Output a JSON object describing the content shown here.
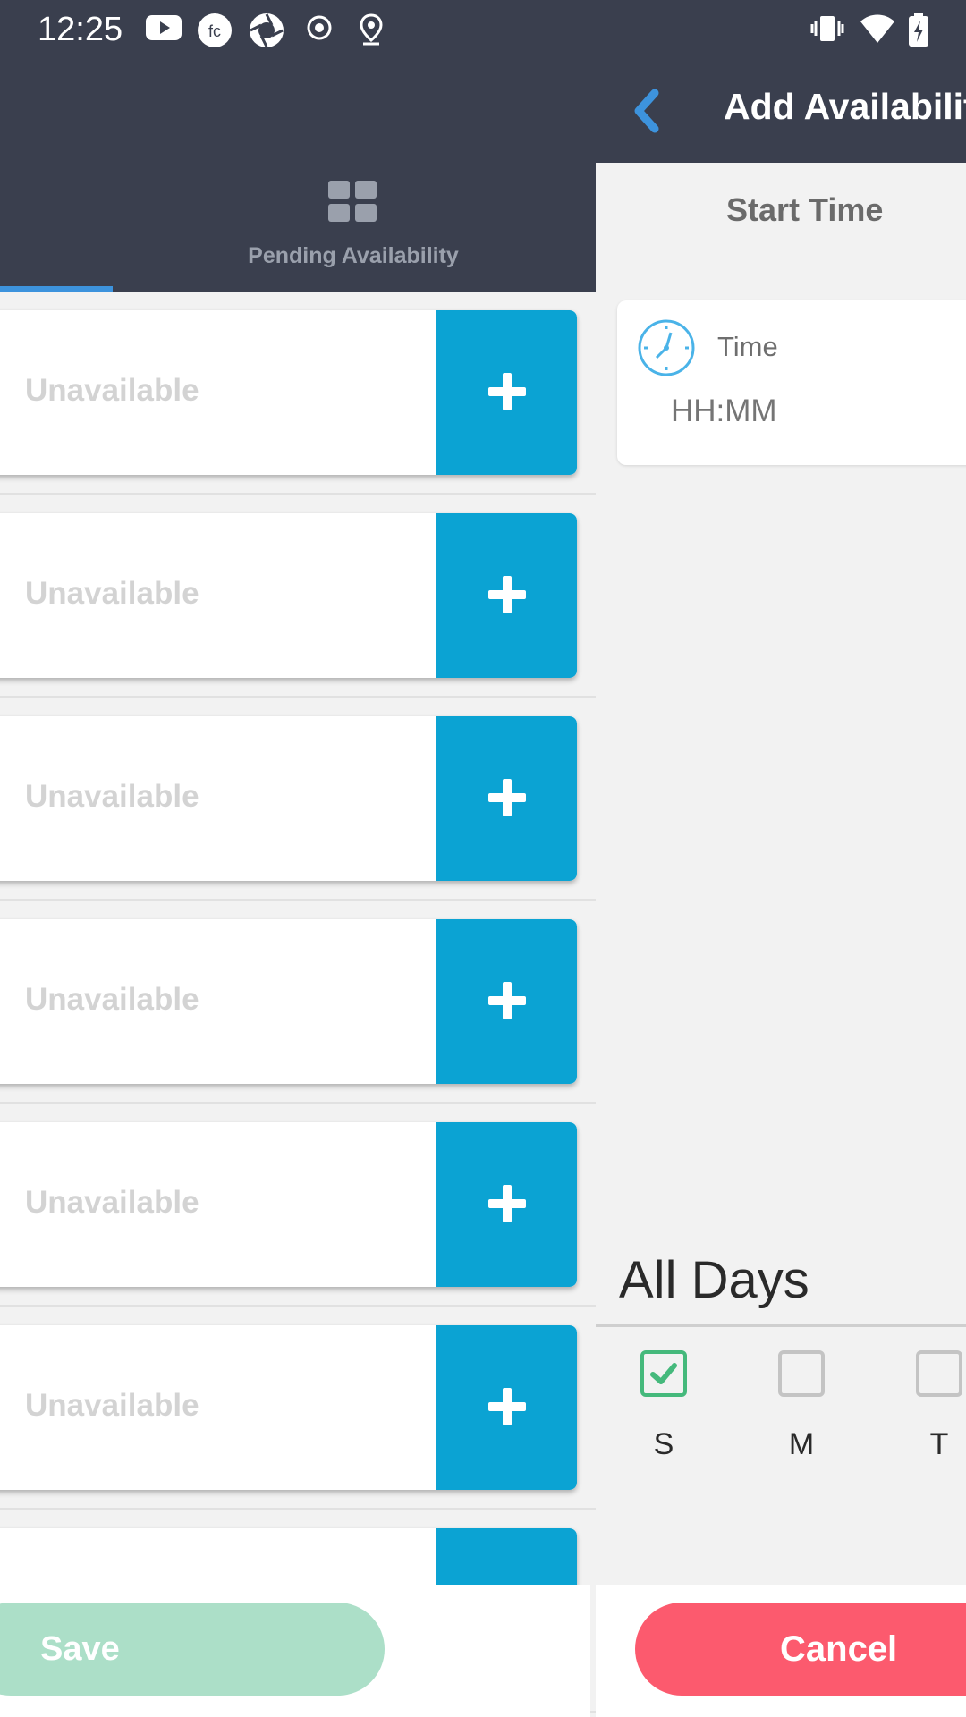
{
  "status_bar": {
    "time": "12:25",
    "left_icons": [
      "youtube-icon",
      "fc-app-icon",
      "camera-shutter-icon",
      "record-icon",
      "location-pin-icon"
    ],
    "right_icons": [
      "vibrate-icon",
      "wifi-icon",
      "battery-charging-icon"
    ]
  },
  "left_pane": {
    "tab_label": "Pending Availability",
    "tab_icon": "grid-icon",
    "slot_label": "Unavailable",
    "slots": [
      {
        "label": "Unavailable"
      },
      {
        "label": "Unavailable"
      },
      {
        "label": "Unavailable"
      },
      {
        "label": "Unavailable"
      },
      {
        "label": "Unavailable"
      },
      {
        "label": "Unavailable"
      },
      {
        "label": ""
      }
    ],
    "save_label": "Save"
  },
  "right_pane": {
    "title": "Add Availabilit",
    "section_title": "Start Time",
    "time_label": "Time",
    "time_placeholder": "HH:MM",
    "all_days_label": "All Days",
    "days": [
      {
        "letter": "S",
        "checked": true
      },
      {
        "letter": "M",
        "checked": false
      },
      {
        "letter": "T",
        "checked": false
      }
    ],
    "cancel_label": "Cancel"
  },
  "colors": {
    "header_bg": "#3a3f4e",
    "add_button": "#0ba3d3",
    "save_button": "#acdfc8",
    "cancel_button": "#fc5a6e",
    "check_green": "#45b97c",
    "accent_blue": "#3d93dd"
  }
}
